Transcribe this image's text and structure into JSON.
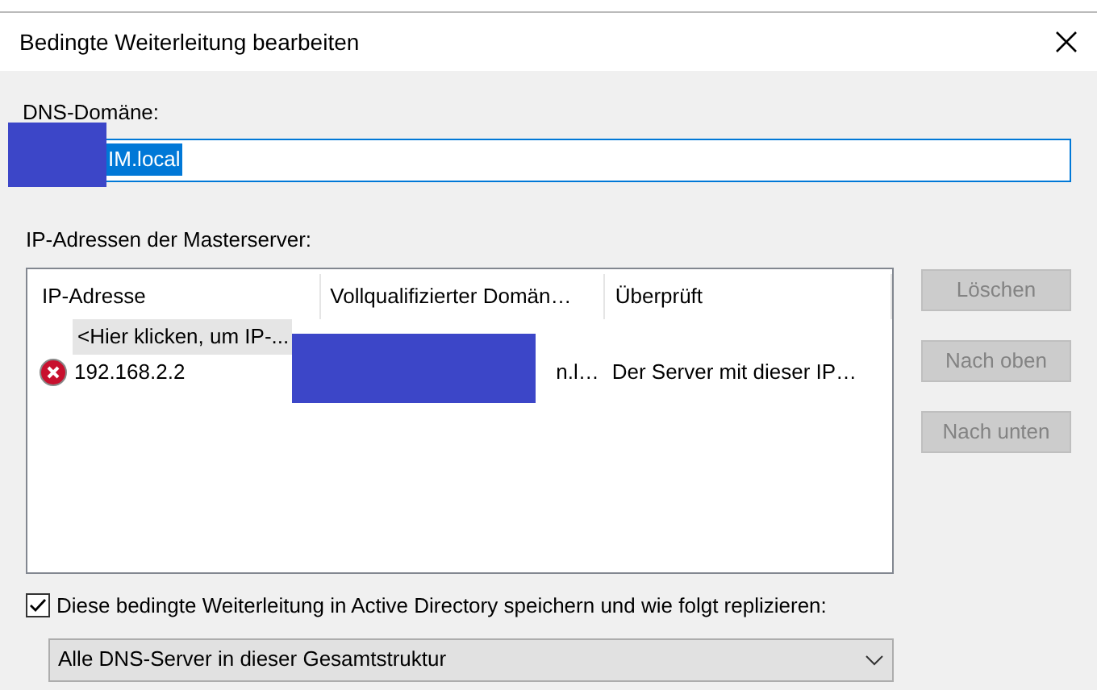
{
  "window": {
    "title": "Bedingte Weiterleitung bearbeiten"
  },
  "domain": {
    "label": "DNS-Domäne:",
    "value": "IM.local",
    "selected": true
  },
  "servers": {
    "label": "IP-Adressen der Masterserver:",
    "columns": [
      "IP-Adresse",
      "Vollqualifizierter Domän…",
      "Überprüft"
    ],
    "rows": [
      {
        "kind": "add",
        "cells": [
          "<Hier klicken, um IP-..."
        ],
        "selected": true
      },
      {
        "kind": "entry",
        "error": true,
        "cells": [
          "192.168.2.2",
          "n.l…",
          "Der Server mit dieser IP…"
        ],
        "selected": false
      }
    ]
  },
  "buttons": [
    {
      "label": "Löschen",
      "disabled": true
    },
    {
      "label": "Nach oben",
      "disabled": true
    },
    {
      "label": "Nach unten",
      "disabled": true
    }
  ],
  "store_in_ad": {
    "label": "Diese bedingte Weiterleitung in Active Directory speichern und wie folgt replizieren:",
    "checked": true
  },
  "replication": {
    "value": "Alle DNS-Server in dieser Gesamtstruktur"
  }
}
